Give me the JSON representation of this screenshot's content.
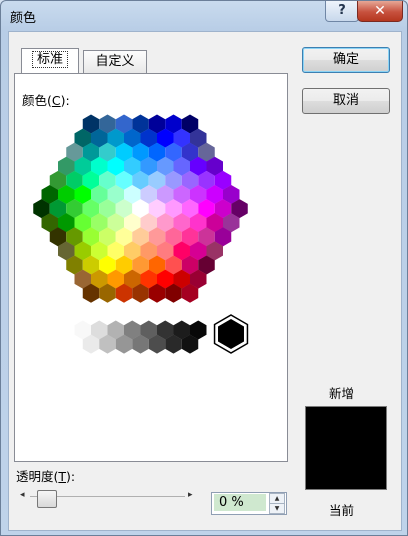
{
  "window": {
    "title": "颜色",
    "help_label": "?",
    "close_label": "✕"
  },
  "tabs": [
    {
      "label": "标准",
      "active": true
    },
    {
      "label": "自定义",
      "active": false
    }
  ],
  "colors_label": {
    "text": "颜色(",
    "mnemonic": "C",
    "suffix": "):"
  },
  "buttons": {
    "ok": "确定",
    "cancel": "取消"
  },
  "preview": {
    "new_label": "新增",
    "current_label": "当前",
    "color": "#000000"
  },
  "transparency": {
    "text": "透明度(",
    "mnemonic": "T",
    "suffix": "):",
    "value": "0 %",
    "fraction": 0.0
  },
  "icons": {
    "slider_left": "arrow-left-icon",
    "slider_right": "arrow-right-icon",
    "spin_up": "arrow-up-icon",
    "spin_down": "arrow-down-icon"
  },
  "hex_rows": [
    [
      "#003366",
      "#336699",
      "#3366CC",
      "#003399",
      "#000099",
      "#0000CC",
      "#000066"
    ],
    [
      "#006666",
      "#006699",
      "#0099CC",
      "#0066CC",
      "#0033CC",
      "#0000FF",
      "#3333FF",
      "#333399"
    ],
    [
      "#669999",
      "#009999",
      "#33CCCC",
      "#00CCFF",
      "#0099FF",
      "#0066FF",
      "#3366FF",
      "#3333CC",
      "#666699"
    ],
    [
      "#339966",
      "#00CC99",
      "#00FFCC",
      "#00FFFF",
      "#33CCFF",
      "#3399FF",
      "#6699FF",
      "#6666FF",
      "#6600FF",
      "#6600CC"
    ],
    [
      "#339933",
      "#00CC66",
      "#00FF99",
      "#66FFCC",
      "#66FFFF",
      "#66CCFF",
      "#99CCFF",
      "#9999FF",
      "#9966FF",
      "#9933FF",
      "#9900FF"
    ],
    [
      "#006600",
      "#00CC00",
      "#00FF00",
      "#66FF99",
      "#99FFCC",
      "#CCFFFF",
      "#CCCCFF",
      "#CC99FF",
      "#CC66FF",
      "#CC33FF",
      "#CC00FF",
      "#9900CC"
    ],
    [
      "#003300",
      "#009933",
      "#33CC33",
      "#66FF66",
      "#99FF99",
      "#CCFFCC",
      "#FFFFFF",
      "#FFCCFF",
      "#FF99FF",
      "#FF66FF",
      "#FF00FF",
      "#CC00CC",
      "#660066"
    ],
    [
      "#336600",
      "#009900",
      "#66FF33",
      "#99FF66",
      "#CCFF99",
      "#FFFFCC",
      "#FFCCCC",
      "#FF99CC",
      "#FF66CC",
      "#FF33CC",
      "#CC0099",
      "#993399"
    ],
    [
      "#333300",
      "#669900",
      "#99FF33",
      "#CCFF66",
      "#FFFF99",
      "#FFCC99",
      "#FF9999",
      "#FF6699",
      "#FF3399",
      "#CC3399",
      "#990099"
    ],
    [
      "#666633",
      "#99CC00",
      "#CCFF33",
      "#FFFF66",
      "#FFCC66",
      "#FF9966",
      "#FF7C80",
      "#FF0066",
      "#D60093",
      "#993366"
    ],
    [
      "#808000",
      "#CCCC00",
      "#FFFF00",
      "#FFCC00",
      "#FF9933",
      "#FF6600",
      "#FF5050",
      "#CC0066",
      "#660033"
    ],
    [
      "#996633",
      "#CC9900",
      "#FF9900",
      "#CC6600",
      "#FF3300",
      "#FF0000",
      "#CC0000",
      "#990033"
    ],
    [
      "#663300",
      "#996600",
      "#CC3300",
      "#993300",
      "#990000",
      "#800000",
      "#A50021"
    ]
  ],
  "gray_rows": [
    [
      "#F8F8F8",
      "#DDDDDD",
      "#B2B2B2",
      "#808080",
      "#5F5F5F",
      "#333333",
      "#1C1C1C",
      "#080808"
    ],
    [
      "#EAEAEA",
      "#C0C0C0",
      "#969696",
      "#777777",
      "#4D4D4D",
      "#292929",
      "#111111"
    ]
  ],
  "selected_color": "#000000"
}
